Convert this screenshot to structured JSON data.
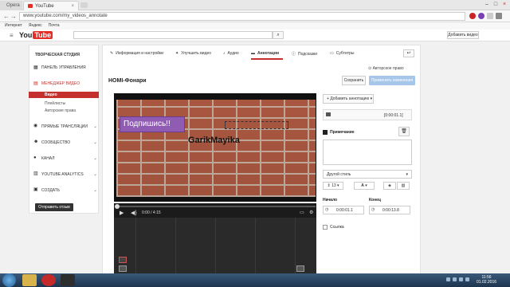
{
  "browser": {
    "tabs": [
      {
        "label": "Opera"
      },
      {
        "label": "YouTube"
      }
    ],
    "url": "www.youtube.com/my_videos_annotate",
    "bookmarks": [
      "Интернет",
      "Яндекс",
      "Почта"
    ]
  },
  "youtube": {
    "logo": "You",
    "logo_tube": "Tube",
    "add_video_label": "Добавить видео"
  },
  "sidebar": {
    "title": "ТВОРЧЕСКАЯ СТУДИЯ",
    "items": [
      {
        "label": "ПАНЕЛЬ УПРАВЛЕНИЯ"
      },
      {
        "label": "МЕНЕДЖЕР ВИДЕО"
      },
      {
        "label": "ПРЯМЫЕ ТРАНСЛЯЦИИ"
      },
      {
        "label": "СООБЩЕСТВО"
      },
      {
        "label": "КАНАЛ"
      },
      {
        "label": "YOUTUBE ANALYTICS"
      },
      {
        "label": "СОЗДАТЬ"
      }
    ],
    "subitems": [
      {
        "label": "Видео"
      },
      {
        "label": "Плейлисты"
      },
      {
        "label": "Авторские права"
      }
    ],
    "feedback_label": "Отправить отзыв"
  },
  "editor": {
    "tabs": [
      {
        "label": "Информация и настройки"
      },
      {
        "label": "Улучшить видео"
      },
      {
        "label": "Аудио"
      },
      {
        "label": "Аннотации"
      },
      {
        "label": "Подсказки"
      },
      {
        "label": "Субтитры"
      }
    ],
    "rights_label": "Авторское право",
    "video_title": "HOMI-Фонари",
    "save_label": "Сохранить",
    "apply_label": "Применить изменения"
  },
  "video": {
    "annotation_text": "Подпишись!!",
    "watermark_text": "GarikMayika",
    "time": "0:00 / 4:15"
  },
  "annotation_panel": {
    "add_label": "Добавить аннотацию",
    "item_time": "0:00:01.1",
    "type_label": "Примечание",
    "style_label": "Другой стиль",
    "font_size": "13",
    "font_label": "A",
    "start_label": "Начало",
    "end_label": "Конец",
    "start_value": "0:00:01.1",
    "end_value": "0:00:13.8",
    "link_label": "Ссылка"
  },
  "taskbar": {
    "time": "11:56",
    "date": "01.02.2016"
  },
  "colors": {
    "brand_red": "#c4302b",
    "annotation_purple": "#8f5bb3",
    "apply_blue": "#a6c7ea"
  }
}
